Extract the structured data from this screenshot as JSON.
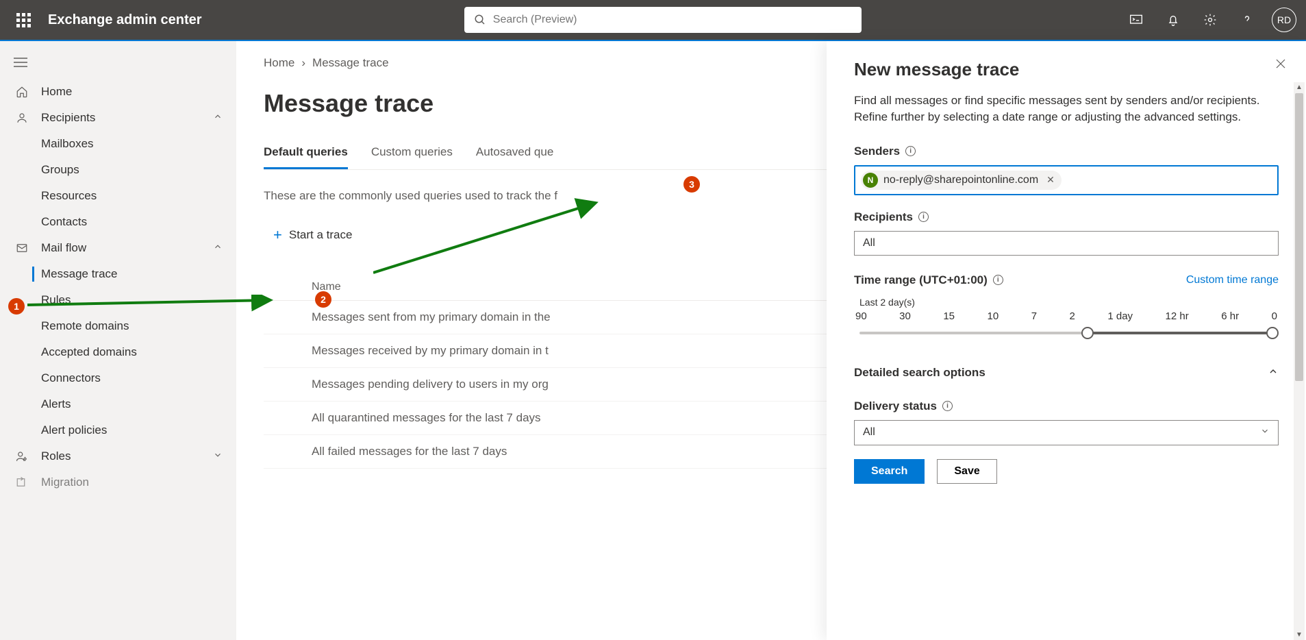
{
  "app_title": "Exchange admin center",
  "search_placeholder": "Search (Preview)",
  "avatar_initials": "RD",
  "nav": {
    "home": "Home",
    "recipients": "Recipients",
    "recipients_children": [
      "Mailboxes",
      "Groups",
      "Resources",
      "Contacts"
    ],
    "mailflow": "Mail flow",
    "mailflow_children": [
      "Message trace",
      "Rules",
      "Remote domains",
      "Accepted domains",
      "Connectors",
      "Alerts",
      "Alert policies"
    ],
    "roles": "Roles",
    "migration": "Migration"
  },
  "breadcrumb": {
    "home": "Home",
    "current": "Message trace"
  },
  "page_title": "Message trace",
  "tabs": {
    "default": "Default queries",
    "custom": "Custom queries",
    "autosaved": "Autosaved que"
  },
  "hint": "These are the commonly used queries used to track the f",
  "start_trace": "Start a trace",
  "table_head": "Name",
  "queries": [
    "Messages sent from my primary domain in the",
    "Messages received by my primary domain in t",
    "Messages pending delivery to users in my org",
    "All quarantined messages for the last 7 days",
    "All failed messages for the last 7 days"
  ],
  "panel": {
    "title": "New message trace",
    "desc": "Find all messages or find specific messages sent by senders and/or recipients. Refine further by selecting a date range or adjusting the advanced settings.",
    "senders_label": "Senders",
    "sender_email": "no-reply@sharepointonline.com",
    "sender_initial": "N",
    "recipients_label": "Recipients",
    "recipients_value": "All",
    "time_label": "Time range (UTC+01:00)",
    "custom_time": "Custom time range",
    "slider_label": "Last 2 day(s)",
    "ticks": [
      "90",
      "30",
      "15",
      "10",
      "7",
      "2",
      "1 day",
      "12 hr",
      "6 hr",
      "0"
    ],
    "detailed": "Detailed search options",
    "delivery_status": "Delivery status",
    "delivery_value": "All",
    "search_btn": "Search",
    "save_btn": "Save"
  }
}
